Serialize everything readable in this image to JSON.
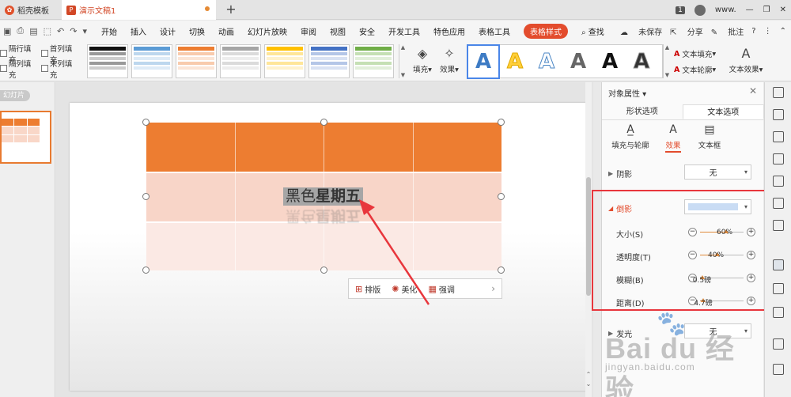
{
  "titlebar": {
    "tabs": [
      {
        "label": "稻壳模板",
        "icon": "docer-icon"
      },
      {
        "label": "演示文稿1",
        "icon": "presentation-icon"
      }
    ],
    "badge": "1",
    "user": "www."
  },
  "menubar": {
    "items": [
      "开始",
      "插入",
      "设计",
      "切换",
      "动画",
      "幻灯片放映",
      "审阅",
      "视图",
      "安全",
      "开发工具",
      "特色应用",
      "表格工具",
      "表格样式"
    ],
    "active": "表格样式",
    "search": "查找",
    "unsaved": "未保存",
    "share": "分享",
    "annotate": "批注",
    "help": "?"
  },
  "ribbon": {
    "checks": [
      "隔行填充",
      "首列填充",
      "隔列填充",
      "末列填充"
    ],
    "fill_label": "填充",
    "effect_label": "效果",
    "text_fill": "文本填充",
    "text_outline": "文本轮廓",
    "text_effect": "文本效果"
  },
  "leftpanel": {
    "tab": "幻灯片"
  },
  "slide": {
    "cell_text_normal": "黑色",
    "cell_text_bold": "星期五",
    "floatbar": {
      "layout": "排版",
      "beautify": "美化",
      "emphasize": "强调"
    }
  },
  "rpanel": {
    "title": "对象属性",
    "tabs": [
      "形状选项",
      "文本选项"
    ],
    "subtabs": [
      "填充与轮廓",
      "效果",
      "文本框"
    ],
    "shadow_label": "阴影",
    "shadow_value": "无",
    "reflection_label": "倒影",
    "glow_label": "发光",
    "glow_value": "无",
    "sliders": [
      {
        "label": "大小(S)",
        "value": "60%",
        "fraction": 0.6
      },
      {
        "label": "透明度(T)",
        "value": "40%",
        "fraction": 0.4
      },
      {
        "label": "模糊(B)",
        "value": "0.5磅",
        "fraction": 0.05
      },
      {
        "label": "距离(D)",
        "value": "4.7磅",
        "fraction": 0.08
      }
    ]
  },
  "watermark": {
    "brand": "Bai du 经验",
    "url": "jingyan.baidu.com"
  }
}
